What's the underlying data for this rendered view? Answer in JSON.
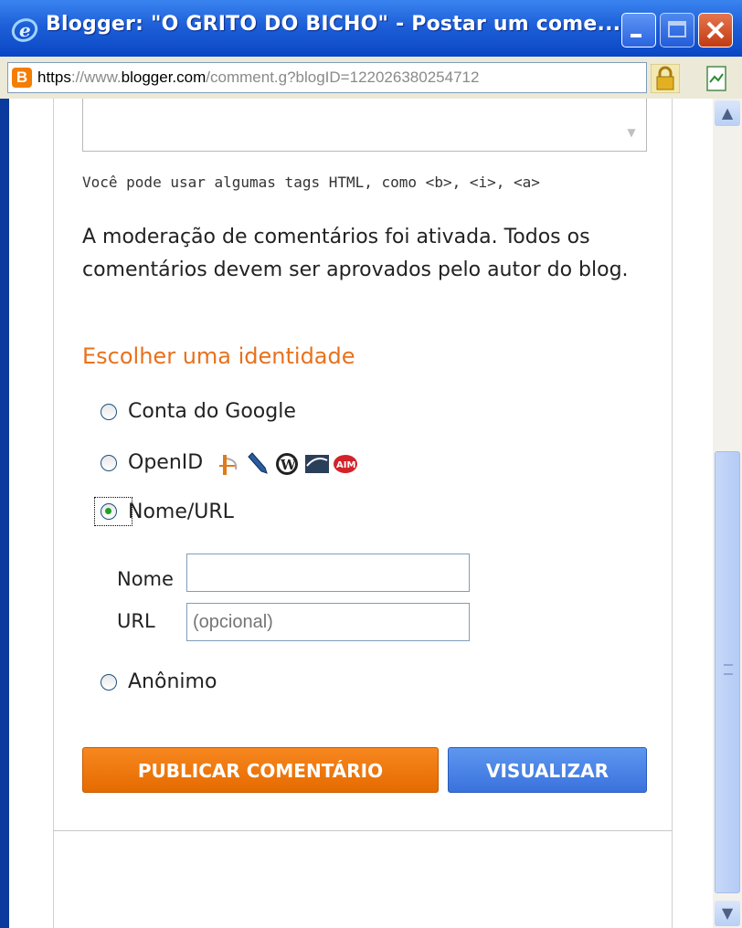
{
  "window": {
    "title": "Blogger: \"O GRITO DO BICHO\" - Postar um come...",
    "icon": "ie-icon"
  },
  "address": {
    "scheme": "https",
    "sep": "://",
    "www": "www.",
    "domain": "blogger.com",
    "path": "/comment.g?blogID=122026380254712"
  },
  "form": {
    "html_tags_note": "Você pode usar algumas tags HTML, como <b>, <i>, <a>",
    "moderation_note": "A moderação de comentários foi ativada. Todos os comentários devem ser aprovados pelo autor do blog.",
    "identity_heading": "Escolher uma identidade",
    "options": {
      "google": "Conta do Google",
      "openid": "OpenID",
      "name_url": "Nome/URL",
      "anonymous": "Anônimo"
    },
    "selected_option": "name_url",
    "name_label": "Nome",
    "name_value": "",
    "url_label": "URL",
    "url_placeholder": "(opcional)",
    "publish_label": "PUBLICAR COMENTÁRIO",
    "preview_label": "VISUALIZAR"
  },
  "colors": {
    "accent_orange": "#e8711c",
    "button_blue": "#3a72dd"
  }
}
